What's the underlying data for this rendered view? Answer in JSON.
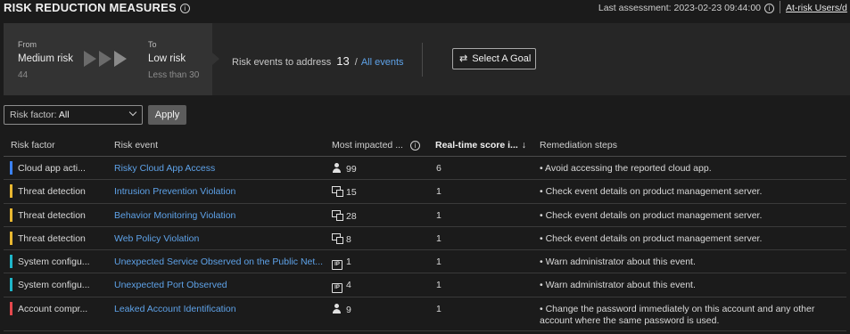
{
  "header": {
    "title": "RISK REDUCTION MEASURES",
    "info_glyph": "i",
    "last_assessment": "Last assessment: 2023-02-23 09:44:00",
    "at_risk_link": "At-risk Users/d"
  },
  "goal_panel": {
    "from_label": "From",
    "from_value": "Medium risk",
    "from_sub": "44",
    "to_label": "To",
    "to_value": "Low risk",
    "to_sub": "Less than 30",
    "events_label": "Risk events to address",
    "events_count": "13",
    "events_sep": "/",
    "all_events_link": "All events",
    "select_goal_label": "Select A Goal"
  },
  "filter": {
    "risk_factor_key": "Risk factor:",
    "risk_factor_value": "All",
    "apply_label": "Apply"
  },
  "table": {
    "columns": {
      "risk_factor": "Risk factor",
      "risk_event": "Risk event",
      "most_impacted": "Most impacted ...",
      "realtime_score": "Real-time score i...",
      "sort_arrow": "↓",
      "remediation": "Remediation steps"
    },
    "rows": [
      {
        "factor": "Cloud app acti...",
        "factor_color": "#3b82f6",
        "event": "Risky Cloud App Access",
        "impact_icon": "user-icon",
        "impact": "99",
        "score": "6",
        "steps": "• Avoid accessing the reported cloud app."
      },
      {
        "factor": "Threat detection",
        "factor_color": "#e8b731",
        "event": "Intrusion Prevention Violation",
        "impact_icon": "device-icon",
        "impact": "15",
        "score": "1",
        "steps": "• Check event details on product management server."
      },
      {
        "factor": "Threat detection",
        "factor_color": "#e8b731",
        "event": "Behavior Monitoring Violation",
        "impact_icon": "device-icon",
        "impact": "28",
        "score": "1",
        "steps": "• Check event details on product management server."
      },
      {
        "factor": "Threat detection",
        "factor_color": "#e8b731",
        "event": "Web Policy Violation",
        "impact_icon": "device-icon",
        "impact": "8",
        "score": "1",
        "steps": "• Check event details on product management server."
      },
      {
        "factor": "System configu...",
        "factor_color": "#1fb6c9",
        "event": "Unexpected Service Observed on the Public Net...",
        "impact_icon": "ip-icon",
        "impact": "1",
        "score": "1",
        "steps": "• Warn administrator about this event."
      },
      {
        "factor": "System configu...",
        "factor_color": "#1fb6c9",
        "event": "Unexpected Port Observed",
        "impact_icon": "ip-icon",
        "impact": "4",
        "score": "1",
        "steps": "• Warn administrator about this event."
      },
      {
        "factor": "Account compr...",
        "factor_color": "#e5484d",
        "event": "Leaked Account Identification",
        "impact_icon": "user-icon",
        "impact": "9",
        "score": "1",
        "steps": "• Change the password immediately on this account and any other account where the same password is used."
      }
    ]
  }
}
